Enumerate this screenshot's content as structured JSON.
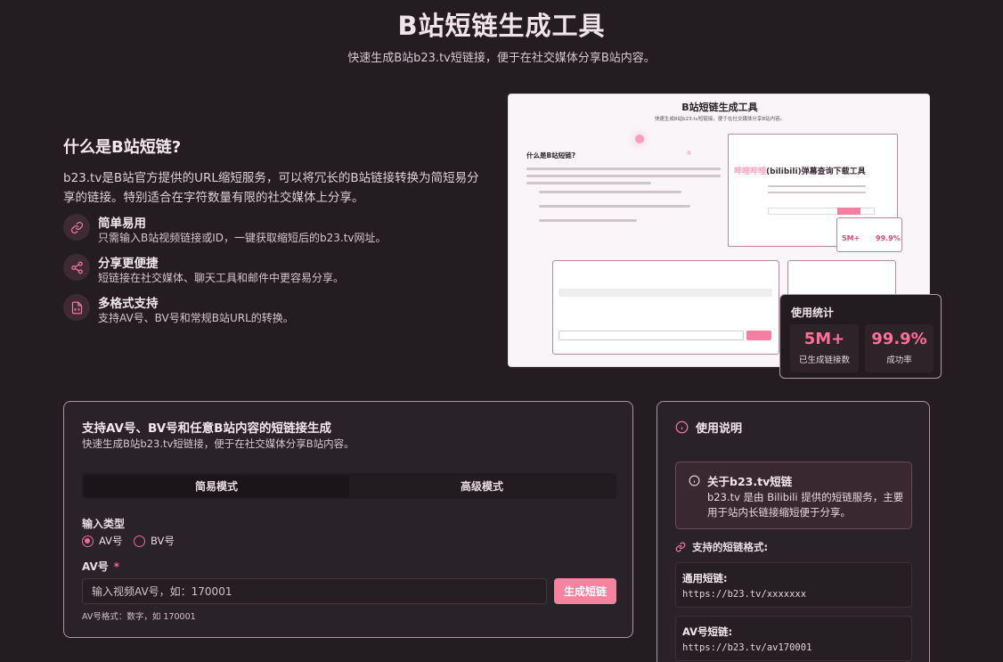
{
  "header": {
    "title": "B站短链生成工具",
    "subtitle": "快速生成B站b23.tv短链接，便于在社交媒体分享B站内容。"
  },
  "intro": {
    "title": "什么是B站短链?",
    "description": "b23.tv是B站官方提供的URL缩短服务，可以将冗长的B站链接转换为简短易分享的链接。特别适合在字符数量有限的社交媒体上分享。",
    "features": [
      {
        "title": "简单易用",
        "desc": "只需输入B站视频链接或ID，一键获取缩短后的b23.tv网址。",
        "icon": "link-icon"
      },
      {
        "title": "分享更便捷",
        "desc": "短链接在社交媒体、聊天工具和邮件中更容易分享。",
        "icon": "share-icon"
      },
      {
        "title": "多格式支持",
        "desc": "支持AV号、BV号和常规B站URL的转换。",
        "icon": "file-code-icon"
      }
    ]
  },
  "preview": {
    "title": "B站短链生成工具",
    "subtitle": "快速生成B站b23.tv短链接，便于在社交媒体分享B站内容。",
    "heading": "什么是B站短链?",
    "shot_title_prefix": "哔哩哔哩",
    "shot_title_main": "(bilibili)弹幕查询下载工具",
    "mini_stat_a": "5M+",
    "mini_stat_b": "99.9%"
  },
  "stats": {
    "title": "使用统计",
    "items": [
      {
        "value": "5M+",
        "label": "已生成链接数"
      },
      {
        "value": "99.9%",
        "label": "成功率"
      }
    ]
  },
  "generator": {
    "title": "支持AV号、BV号和任意B站内容的短链接生成",
    "subtitle": "快速生成B站b23.tv短链接，便于在社交媒体分享B站内容。",
    "tabs": [
      "简易模式",
      "高级模式"
    ],
    "input_type_label": "输入类型",
    "radio_options": [
      "AV号",
      "BV号"
    ],
    "selected": "AV号",
    "av_label": "AV号",
    "required_mark": "*",
    "av_placeholder": "输入视频AV号，如：170001",
    "submit_label": "生成短链",
    "hint": "AV号格式：数字，如 170001"
  },
  "usage": {
    "title": "使用说明",
    "about_title": "关于b23.tv短链",
    "about_desc": "b23.tv 是由 Bilibili 提供的短链服务，主要用于站内长链接缩短便于分享。",
    "formats_title": "支持的短链格式:",
    "formats": [
      {
        "name": "通用短链:",
        "url": "https://b23.tv/xxxxxxx"
      },
      {
        "name": "AV号短链:",
        "url": "https://b23.tv/av170001"
      }
    ]
  },
  "colors": {
    "accent": "#f7829f",
    "background": "#231d22",
    "card": "#2a2229"
  }
}
